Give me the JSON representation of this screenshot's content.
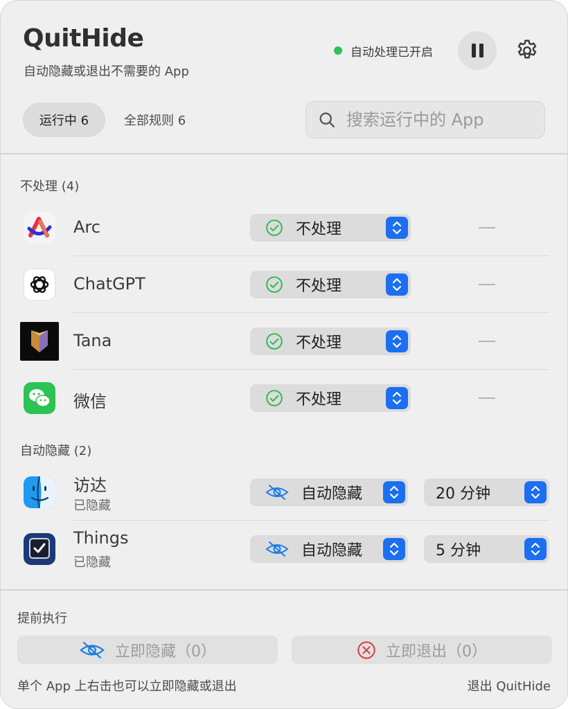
{
  "header": {
    "title": "QuitHide",
    "subtitle": "自动隐藏或退出不需要的 App",
    "status_text": "自动处理已开启"
  },
  "tabs": [
    {
      "label": "运行中 6",
      "selected": true
    },
    {
      "label": "全部规则 6",
      "selected": false
    }
  ],
  "search": {
    "placeholder": "搜索运行中的 App",
    "value": ""
  },
  "sections": {
    "ignore": {
      "header": "不处理 (4)",
      "apps": [
        {
          "name": "Arc",
          "mode": "不处理",
          "delay": "—"
        },
        {
          "name": "ChatGPT",
          "mode": "不处理",
          "delay": "—"
        },
        {
          "name": "Tana",
          "mode": "不处理",
          "delay": "—"
        },
        {
          "name": "微信",
          "mode": "不处理",
          "delay": "—"
        }
      ]
    },
    "autohide": {
      "header": "自动隐藏 (2)",
      "apps": [
        {
          "name": "访达",
          "status": "已隐藏",
          "mode": "自动隐藏",
          "delay": "20 分钟"
        },
        {
          "name": "Things",
          "status": "已隐藏",
          "mode": "自动隐藏",
          "delay": "5 分钟"
        }
      ]
    }
  },
  "footer": {
    "advance_label": "提前执行",
    "hide_now": "立即隐藏（0）",
    "quit_now": "立即退出（0）",
    "hint": "单个 App 上右击也可以立即隐藏或退出",
    "quit_app": "退出 QuitHide"
  },
  "colors": {
    "accent": "#1c6ff0",
    "status_green": "#30c15a",
    "ignore_check": "#2fb84d",
    "hide_icon": "#1a7ee6",
    "quit_icon": "#e03a3a"
  },
  "icons": {
    "arc": "arc-app-icon",
    "chatgpt": "chatgpt-app-icon",
    "tana": "tana-app-icon",
    "wechat": "wechat-app-icon",
    "finder": "finder-app-icon",
    "things": "things-app-icon"
  }
}
